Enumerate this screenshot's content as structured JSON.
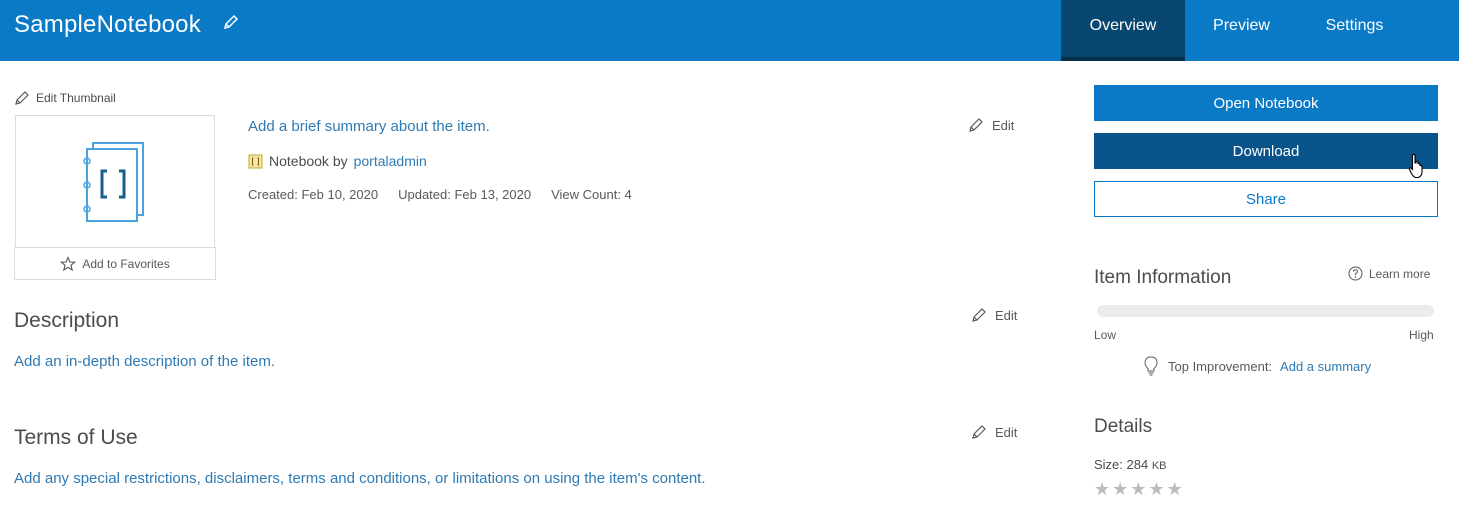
{
  "header": {
    "title": "SampleNotebook",
    "tabs": [
      {
        "label": "Overview",
        "active": true
      },
      {
        "label": "Preview",
        "active": false
      },
      {
        "label": "Settings",
        "active": false
      }
    ],
    "colors": {
      "bar": "#0a7ac7",
      "active_tab": "#08476f"
    }
  },
  "thumbnail": {
    "edit_label": "Edit Thumbnail",
    "icon": "notebook-icon",
    "favorites_label": "Add to Favorites"
  },
  "item": {
    "summary_placeholder": "Add a brief summary about the item.",
    "type_label": "Notebook by",
    "owner": "portaladmin",
    "created": "Created: Feb 10, 2020",
    "updated": "Updated: Feb 13, 2020",
    "view_count": "View Count: 4",
    "edit_label": "Edit"
  },
  "description": {
    "title": "Description",
    "placeholder": "Add an in-depth description of the item.",
    "edit_label": "Edit"
  },
  "terms": {
    "title": "Terms of Use",
    "placeholder": "Add any special restrictions, disclaimers, terms and conditions, or limitations on using the item's content.",
    "edit_label": "Edit"
  },
  "actions": {
    "open": "Open Notebook",
    "download": "Download",
    "share": "Share"
  },
  "item_information": {
    "title": "Item Information",
    "learn_more": "Learn more",
    "progress": 0,
    "low": "Low",
    "high": "High",
    "improvement_label": "Top Improvement:",
    "improvement_link": "Add a summary"
  },
  "details": {
    "title": "Details",
    "size_label": "Size: 284",
    "size_unit": "KB",
    "rating": 0,
    "rating_max": 5
  }
}
